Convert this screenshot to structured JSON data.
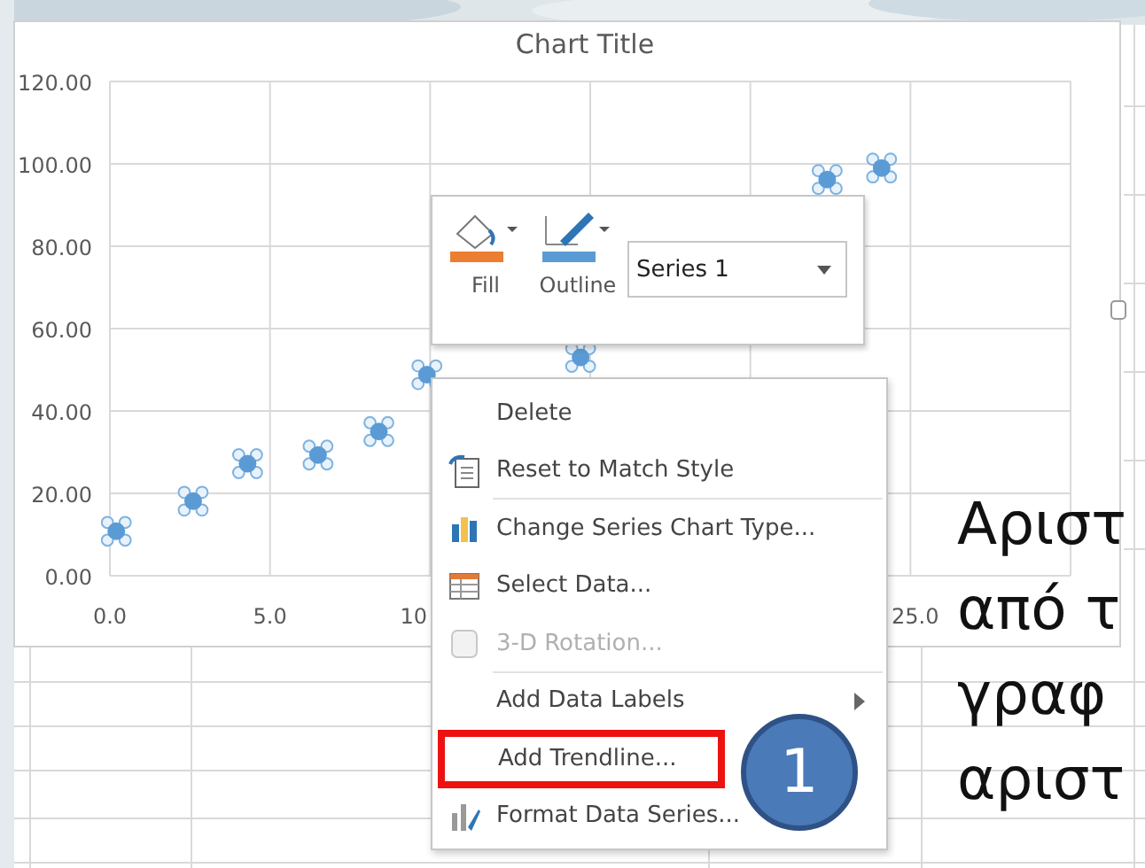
{
  "chart": {
    "title": "Chart Title",
    "cut_axis_label": "10",
    "chart_data": {
      "type": "scatter",
      "grid": true,
      "ylim": [
        0,
        120
      ],
      "xlim": [
        0,
        30
      ],
      "yticks": [
        {
          "value": 0,
          "label": "0.00"
        },
        {
          "value": 20,
          "label": "20.00"
        },
        {
          "value": 40,
          "label": "40.00"
        },
        {
          "value": 60,
          "label": "60.00"
        },
        {
          "value": 80,
          "label": "80.00"
        },
        {
          "value": 100,
          "label": "100.00"
        },
        {
          "value": 120,
          "label": "120.00"
        }
      ],
      "xticks": [
        {
          "value": 0,
          "label": "0.0"
        },
        {
          "value": 5,
          "label": "5.0"
        },
        {
          "value": 25,
          "label": "25.0"
        }
      ],
      "series": [
        {
          "name": "Series 1",
          "color": "#5b9bd5",
          "x": [
            0.2,
            2.6,
            4.3,
            6.5,
            8.4,
            9.9,
            14.7,
            22.4,
            24.1
          ],
          "values": [
            10.8,
            18.1,
            27.2,
            29.3,
            35,
            48.8,
            53,
            96.2,
            99
          ]
        }
      ]
    }
  },
  "mini_toolbar": {
    "buttons": [
      {
        "kind": "fill",
        "label": "Fill",
        "color": "#ed7d31"
      },
      {
        "kind": "outline",
        "label": "Outline",
        "color": "#5b9bd5"
      }
    ]
  },
  "context_menu": {
    "items": [
      {
        "kind": "delete",
        "label": "Delete",
        "disabled": false,
        "submenu": false,
        "separator_after": false
      },
      {
        "kind": "reset",
        "label": "Reset to Match Style",
        "disabled": false,
        "submenu": false,
        "separator_after": true
      },
      {
        "kind": "chart-type",
        "label": "Change Series Chart Type...",
        "disabled": false,
        "submenu": false,
        "separator_after": false
      },
      {
        "kind": "select-data",
        "label": "Select Data...",
        "disabled": false,
        "submenu": false,
        "separator_after": false
      },
      {
        "kind": "rotation",
        "label": "3-D Rotation...",
        "disabled": true,
        "submenu": false,
        "separator_after": true
      },
      {
        "kind": "plain",
        "label": "Add Data Labels",
        "disabled": false,
        "submenu": true,
        "separator_after": false
      },
      {
        "kind": "plain",
        "label": "Add Trendline...",
        "disabled": false,
        "submenu": false,
        "separator_after": false,
        "highlighted": true
      },
      {
        "kind": "format",
        "label": "Format Data Series...",
        "disabled": false,
        "submenu": false,
        "separator_after": false
      }
    ]
  },
  "step_badge": {
    "label": "1"
  },
  "slide_text": [
    "Αριστ",
    "από τ",
    "γραφ",
    "αριστ"
  ]
}
